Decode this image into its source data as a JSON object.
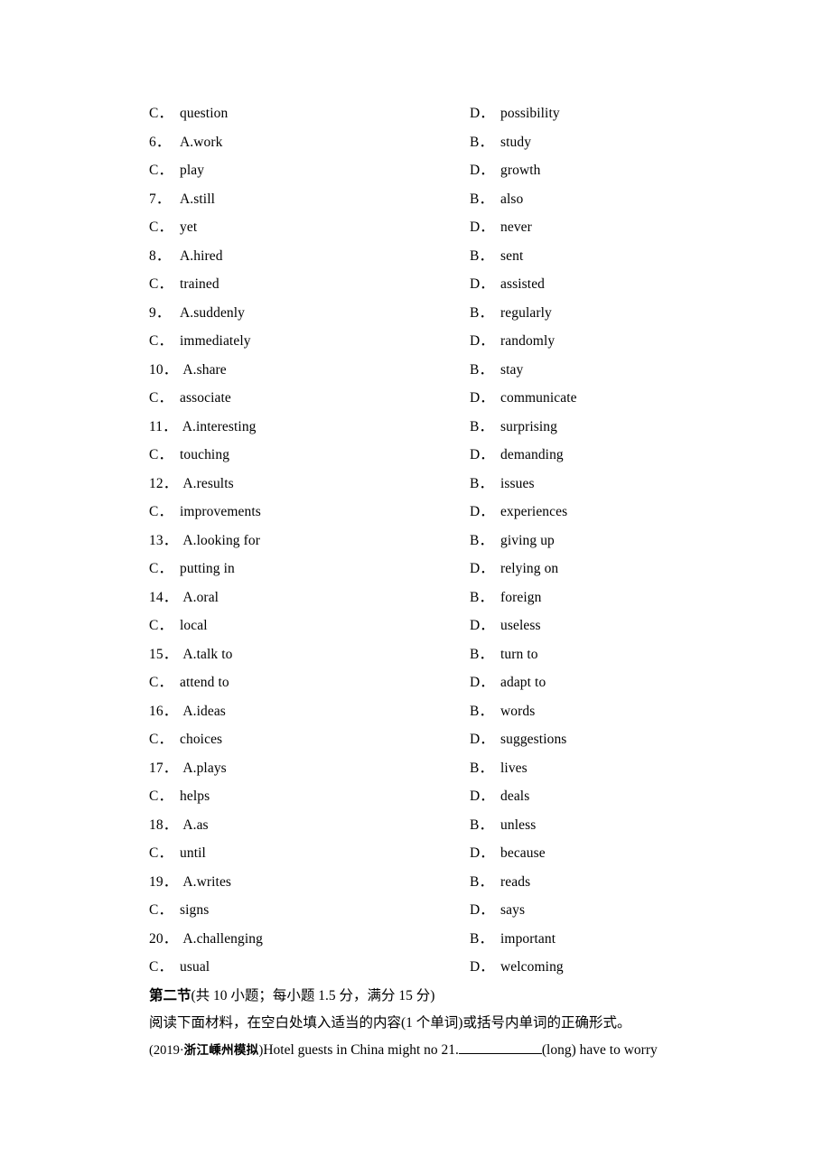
{
  "document": {
    "type": "exam-worksheet-page",
    "options_rows": [
      {
        "left_tag": "C．",
        "left_text": "question",
        "right_tag": "D．",
        "right_text": "possibility"
      },
      {
        "left_tag": "6．",
        "left_text": "A.work",
        "right_tag": "B．",
        "right_text": "study"
      },
      {
        "left_tag": "C．",
        "left_text": "play",
        "right_tag": "D．",
        "right_text": "growth"
      },
      {
        "left_tag": "7．",
        "left_text": "A.still",
        "right_tag": "B．",
        "right_text": "also"
      },
      {
        "left_tag": "C．",
        "left_text": "yet",
        "right_tag": "D．",
        "right_text": "never"
      },
      {
        "left_tag": "8．",
        "left_text": "A.hired",
        "right_tag": "B．",
        "right_text": "sent"
      },
      {
        "left_tag": "C．",
        "left_text": "trained",
        "right_tag": "D．",
        "right_text": "assisted"
      },
      {
        "left_tag": "9．",
        "left_text": "A.suddenly",
        "right_tag": "B．",
        "right_text": "regularly"
      },
      {
        "left_tag": "C．",
        "left_text": "immediately",
        "right_tag": "D．",
        "right_text": "randomly"
      },
      {
        "left_tag": "10．",
        "left_text": "A.share",
        "right_tag": "B．",
        "right_text": "stay"
      },
      {
        "left_tag": "C．",
        "left_text": "associate",
        "right_tag": "D．",
        "right_text": "communicate"
      },
      {
        "left_tag": "11．",
        "left_text": "A.interesting",
        "right_tag": "B．",
        "right_text": "surprising"
      },
      {
        "left_tag": "C．",
        "left_text": "touching",
        "right_tag": "D．",
        "right_text": "demanding"
      },
      {
        "left_tag": "12．",
        "left_text": "A.results",
        "right_tag": "B．",
        "right_text": "issues"
      },
      {
        "left_tag": "C．",
        "left_text": "improvements",
        "right_tag": "D．",
        "right_text": "experiences"
      },
      {
        "left_tag": "13．",
        "left_text": "A.looking for",
        "right_tag": "B．",
        "right_text": "giving up"
      },
      {
        "left_tag": "C．",
        "left_text": "putting in",
        "right_tag": "D．",
        "right_text": "relying on"
      },
      {
        "left_tag": "14．",
        "left_text": "A.oral",
        "right_tag": "B．",
        "right_text": "foreign"
      },
      {
        "left_tag": "C．",
        "left_text": "local",
        "right_tag": "D．",
        "right_text": "useless"
      },
      {
        "left_tag": "15．",
        "left_text": "A.talk to",
        "right_tag": "B．",
        "right_text": "turn to"
      },
      {
        "left_tag": "C．",
        "left_text": "attend to",
        "right_tag": "D．",
        "right_text": "adapt to"
      },
      {
        "left_tag": "16．",
        "left_text": "A.ideas",
        "right_tag": "B．",
        "right_text": "words"
      },
      {
        "left_tag": "C．",
        "left_text": "choices",
        "right_tag": "D．",
        "right_text": "suggestions"
      },
      {
        "left_tag": "17．",
        "left_text": "A.plays",
        "right_tag": "B．",
        "right_text": "lives"
      },
      {
        "left_tag": "C．",
        "left_text": "helps",
        "right_tag": "D．",
        "right_text": "deals"
      },
      {
        "left_tag": "18．",
        "left_text": "A.as",
        "right_tag": "B．",
        "right_text": "unless"
      },
      {
        "left_tag": "C．",
        "left_text": "until",
        "right_tag": "D．",
        "right_text": "because"
      },
      {
        "left_tag": "19．",
        "left_text": "A.writes",
        "right_tag": "B．",
        "right_text": "reads"
      },
      {
        "left_tag": "C．",
        "left_text": "signs",
        "right_tag": "D．",
        "right_text": "says"
      },
      {
        "left_tag": "20．",
        "left_text": "A.challenging",
        "right_tag": "B．",
        "right_text": "important"
      },
      {
        "left_tag": "C．",
        "left_text": "usual",
        "right_tag": "D．",
        "right_text": "welcoming"
      }
    ],
    "section": {
      "heading_bold": "第二节",
      "heading_rest": "(共 10 小题；每小题 1.5 分，满分 15 分)",
      "instruction": "阅读下面材料，在空白处填入适当的内容(1 个单词)或括号内单词的正确形式。"
    },
    "passage": {
      "source_open": "(2019·",
      "source_cn": "浙江嵊州模拟",
      "source_close": ")",
      "text_before_blank": "Hotel guests in China might no 21.",
      "text_after_blank": "(long) have to worry"
    }
  }
}
